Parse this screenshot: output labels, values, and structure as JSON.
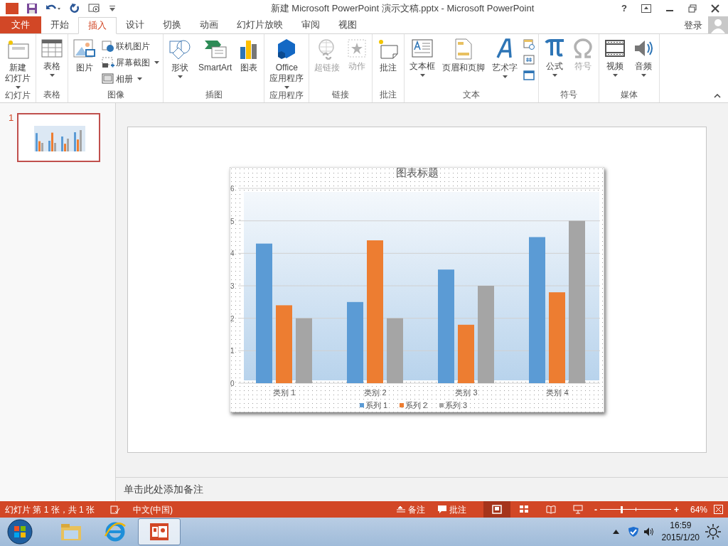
{
  "window": {
    "title": "新建 Microsoft PowerPoint 演示文稿.pptx - Microsoft PowerPoint",
    "help": "?",
    "sign_in": "登录"
  },
  "tabs": [
    {
      "label": "文件",
      "kind": "file",
      "selected": false
    },
    {
      "label": "开始",
      "kind": "tab",
      "selected": false
    },
    {
      "label": "插入",
      "kind": "tab",
      "selected": true
    },
    {
      "label": "设计",
      "kind": "tab",
      "selected": false
    },
    {
      "label": "切换",
      "kind": "tab",
      "selected": false
    },
    {
      "label": "动画",
      "kind": "tab",
      "selected": false
    },
    {
      "label": "幻灯片放映",
      "kind": "tab",
      "selected": false
    },
    {
      "label": "审阅",
      "kind": "tab",
      "selected": false
    },
    {
      "label": "视图",
      "kind": "tab",
      "selected": false
    }
  ],
  "ribbon": {
    "groups": [
      {
        "label": "幻灯片",
        "items": [
          {
            "kind": "large",
            "label": [
              "新建",
              "幻灯片"
            ],
            "dropdown": true,
            "disabled": false
          }
        ]
      },
      {
        "label": "表格",
        "items": [
          {
            "kind": "large",
            "label": "表格",
            "dropdown": true,
            "disabled": false
          }
        ]
      },
      {
        "label": "图像",
        "items": [
          {
            "kind": "large",
            "label": "图片",
            "dropdown": false,
            "disabled": false
          },
          {
            "kind": "small",
            "label": "联机图片",
            "dropdown": false,
            "disabled": false
          },
          {
            "kind": "small",
            "label": "屏幕截图",
            "dropdown": true,
            "disabled": false
          },
          {
            "kind": "small",
            "label": "相册",
            "dropdown": true,
            "disabled": false
          }
        ]
      },
      {
        "label": "插图",
        "items": [
          {
            "kind": "large",
            "label": "形状",
            "dropdown": true,
            "disabled": false
          },
          {
            "kind": "large",
            "label": "SmartArt",
            "dropdown": false,
            "disabled": false
          },
          {
            "kind": "large",
            "label": "图表",
            "dropdown": false,
            "disabled": false
          }
        ]
      },
      {
        "label": "应用程序",
        "items": [
          {
            "kind": "large",
            "label": [
              "Office",
              "应用程序"
            ],
            "dropdown": true,
            "disabled": false
          }
        ]
      },
      {
        "label": "链接",
        "items": [
          {
            "kind": "large",
            "label": "超链接",
            "dropdown": false,
            "disabled": true
          },
          {
            "kind": "large",
            "label": "动作",
            "dropdown": false,
            "disabled": true
          }
        ]
      },
      {
        "label": "批注",
        "items": [
          {
            "kind": "large",
            "label": "批注",
            "dropdown": false,
            "disabled": false
          }
        ]
      },
      {
        "label": "文本",
        "items": [
          {
            "kind": "large",
            "label": "文本框",
            "dropdown": true,
            "disabled": false
          },
          {
            "kind": "large",
            "label": "页眉和页脚",
            "dropdown": false,
            "disabled": false
          },
          {
            "kind": "large",
            "label": "艺术字",
            "dropdown": true,
            "disabled": false
          },
          {
            "kind": "icons",
            "disabled": false
          }
        ]
      },
      {
        "label": "符号",
        "items": [
          {
            "kind": "large",
            "label": "公式",
            "dropdown": true,
            "disabled": false
          },
          {
            "kind": "large",
            "label": "符号",
            "dropdown": false,
            "disabled": true
          }
        ]
      },
      {
        "label": "媒体",
        "items": [
          {
            "kind": "large",
            "label": "视频",
            "dropdown": true,
            "disabled": false
          },
          {
            "kind": "large",
            "label": "音频",
            "dropdown": true,
            "disabled": false
          }
        ]
      }
    ]
  },
  "thumbnails": [
    {
      "number": "1",
      "selected": true
    }
  ],
  "slide": {
    "chart_data": {
      "type": "bar",
      "title": "图表标题",
      "categories": [
        "类别 1",
        "类别 2",
        "类别 3",
        "类别 4"
      ],
      "series": [
        {
          "name": "系列 1",
          "color": "#5b9bd5",
          "values": [
            4.3,
            2.5,
            3.5,
            4.5
          ]
        },
        {
          "name": "系列 2",
          "color": "#ed7d31",
          "values": [
            2.4,
            4.4,
            1.8,
            2.8
          ]
        },
        {
          "name": "系列 3",
          "color": "#a5a5a5",
          "values": [
            2,
            2,
            3,
            5
          ]
        }
      ],
      "ylim": [
        0,
        6
      ],
      "yticks": [
        0,
        1,
        2,
        3,
        4,
        5,
        6
      ],
      "grid": true,
      "legend": "bottom"
    }
  },
  "notes": {
    "text": "单击此处添加备注"
  },
  "status_bar": {
    "slide_info": "幻灯片 第 1 张，共 1 张",
    "language": "中文(中国)",
    "notes": "备注",
    "comments": "批注",
    "views": [
      {
        "selected": true
      },
      {
        "selected": false
      },
      {
        "selected": false
      },
      {
        "selected": false
      }
    ],
    "zoom": {
      "minus": "-",
      "plus": "+",
      "level": 0.3,
      "reading": "64%"
    }
  },
  "taskbar": {
    "apps": [
      {
        "selected": false
      },
      {
        "selected": false
      },
      {
        "selected": true
      }
    ],
    "time": "16:59",
    "date": "2015/1/20"
  }
}
